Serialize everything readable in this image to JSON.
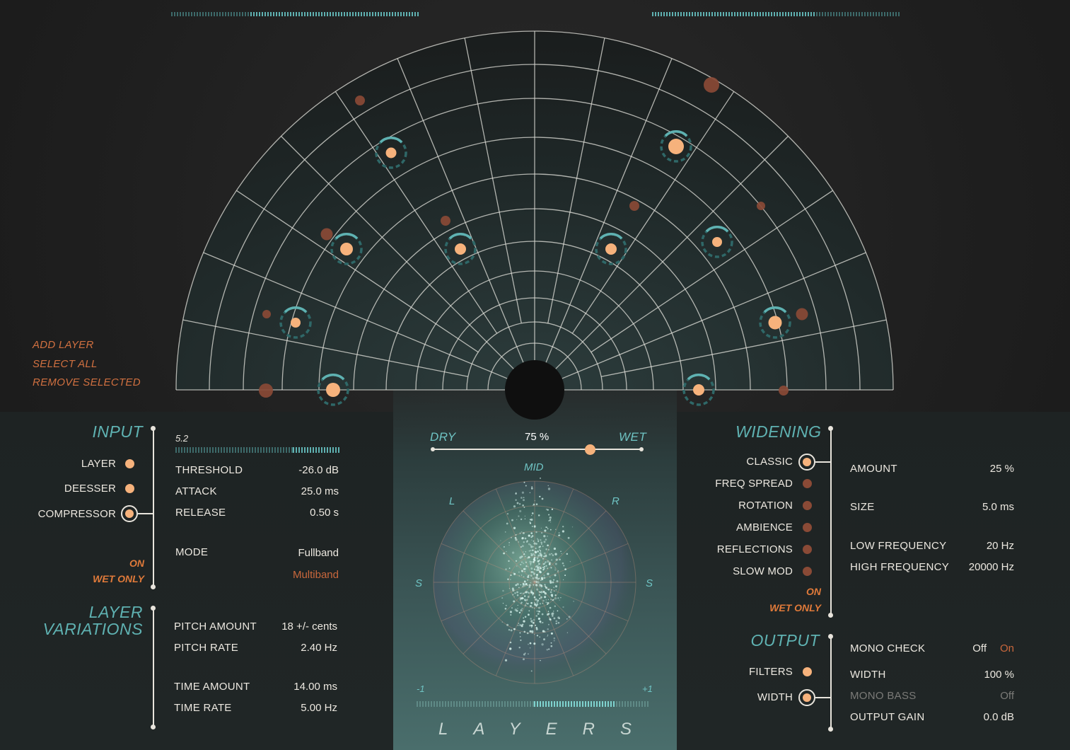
{
  "actions": {
    "add_layer": "ADD LAYER",
    "select_all": "SELECT ALL",
    "remove_selected": "REMOVE SELECTED"
  },
  "input": {
    "title": "INPUT",
    "meter_value": "5.2",
    "meter_level": 0.7,
    "modules": [
      {
        "label": "LAYER",
        "state": "active"
      },
      {
        "label": "DEESSER",
        "state": "active"
      },
      {
        "label": "COMPRESSOR",
        "state": "selected"
      }
    ],
    "on_label": "ON",
    "wet_only_label": "WET ONLY",
    "params": [
      {
        "label": "THRESHOLD",
        "value": "-26.0 dB"
      },
      {
        "label": "ATTACK",
        "value": "25.0 ms"
      },
      {
        "label": "RELEASE",
        "value": "0.50 s"
      }
    ],
    "mode": {
      "label": "MODE",
      "options": [
        "Fullband",
        "Multiband"
      ],
      "selected": "Multiband"
    }
  },
  "layer_variations": {
    "title_line1": "LAYER",
    "title_line2": "VARIATIONS",
    "params": [
      {
        "label": "PITCH AMOUNT",
        "value": "18 +/- cents"
      },
      {
        "label": "PITCH RATE",
        "value": "2.40 Hz"
      },
      {
        "label": "TIME AMOUNT",
        "value": "14.00 ms"
      },
      {
        "label": "TIME RATE",
        "value": "5.00 Hz"
      }
    ]
  },
  "mix": {
    "dry_label": "DRY",
    "wet_label": "WET",
    "percent_text": "75 %",
    "value": 0.75
  },
  "scope": {
    "mid_label": "MID",
    "left_label": "L",
    "right_label": "R",
    "side_left_label": "S",
    "side_right_label": "S",
    "min_label": "-1",
    "max_label": "+1",
    "title": "LAYERS"
  },
  "widening": {
    "title": "WIDENING",
    "modules": [
      {
        "label": "CLASSIC",
        "state": "selected"
      },
      {
        "label": "FREQ SPREAD",
        "state": "dim"
      },
      {
        "label": "ROTATION",
        "state": "dim"
      },
      {
        "label": "AMBIENCE",
        "state": "dim"
      },
      {
        "label": "REFLECTIONS",
        "state": "dim"
      },
      {
        "label": "SLOW MOD",
        "state": "dim"
      }
    ],
    "on_label": "ON",
    "wet_only_label": "WET ONLY",
    "params": [
      {
        "label": "AMOUNT",
        "value": "25 %"
      },
      {
        "label": "SIZE",
        "value": "5.0 ms"
      },
      {
        "label": "LOW FREQUENCY",
        "value": "20 Hz"
      },
      {
        "label": "HIGH FREQUENCY",
        "value": "20000 Hz"
      }
    ]
  },
  "output": {
    "title": "OUTPUT",
    "modules": [
      {
        "label": "FILTERS",
        "state": "active"
      },
      {
        "label": "WIDTH",
        "state": "selected"
      }
    ],
    "mono_check": {
      "label": "MONO CHECK",
      "off": "Off",
      "on": "On",
      "selected": "Off"
    },
    "params": [
      {
        "label": "WIDTH",
        "value": "100 %",
        "enabled": true
      },
      {
        "label": "MONO BASS",
        "value": "Off",
        "enabled": false
      },
      {
        "label": "OUTPUT GAIN",
        "value": "0.0 dB",
        "enabled": true
      }
    ]
  },
  "colors": {
    "accent_orange": "#f6b27c",
    "dim_orange": "#8a4a36",
    "teal": "#5fb2b2",
    "link_orange": "#d07040"
  }
}
